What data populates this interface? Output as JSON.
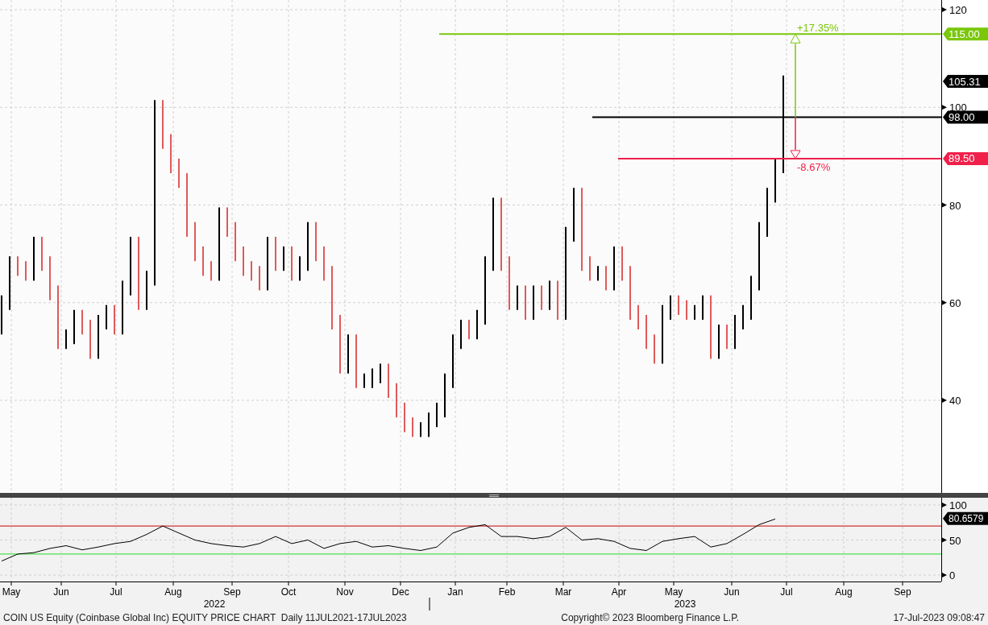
{
  "price_chart": {
    "y_axis_labels": [
      "120",
      "100",
      "80",
      "60",
      "40"
    ],
    "level_labels": [
      {
        "kind": "level",
        "text": "115.00",
        "color": "#7ac70c"
      },
      {
        "kind": "last",
        "text": "105.31",
        "color": "#000000"
      },
      {
        "kind": "level",
        "text": "98.00",
        "color": "#000000"
      },
      {
        "kind": "level",
        "text": "89.50",
        "color": "#f0204a"
      }
    ],
    "change_arrow": {
      "up_label": "+17.35%",
      "down_label": "-8.67%"
    }
  },
  "rsi_chart": {
    "y_axis_labels": [
      "100",
      "50",
      "0"
    ],
    "last_label": "80.6579"
  },
  "months": [
    "May",
    "Jun",
    "Jul",
    "Aug",
    "Sep",
    "Oct",
    "Nov",
    "Dec",
    "Jan",
    "Feb",
    "Mar",
    "Apr",
    "May",
    "Jun",
    "Jul",
    "Aug",
    "Sep"
  ],
  "years": [
    "2022",
    "2023"
  ],
  "footer": {
    "title": "COIN US Equity (Coinbase Global Inc) EQUITY PRICE CHART  Daily 11JUL2021-17JUL2023",
    "copyright": "Copyright© 2023 Bloomberg Finance L.P.",
    "timestamp": "17-Jul-2023 09:08:47"
  }
}
